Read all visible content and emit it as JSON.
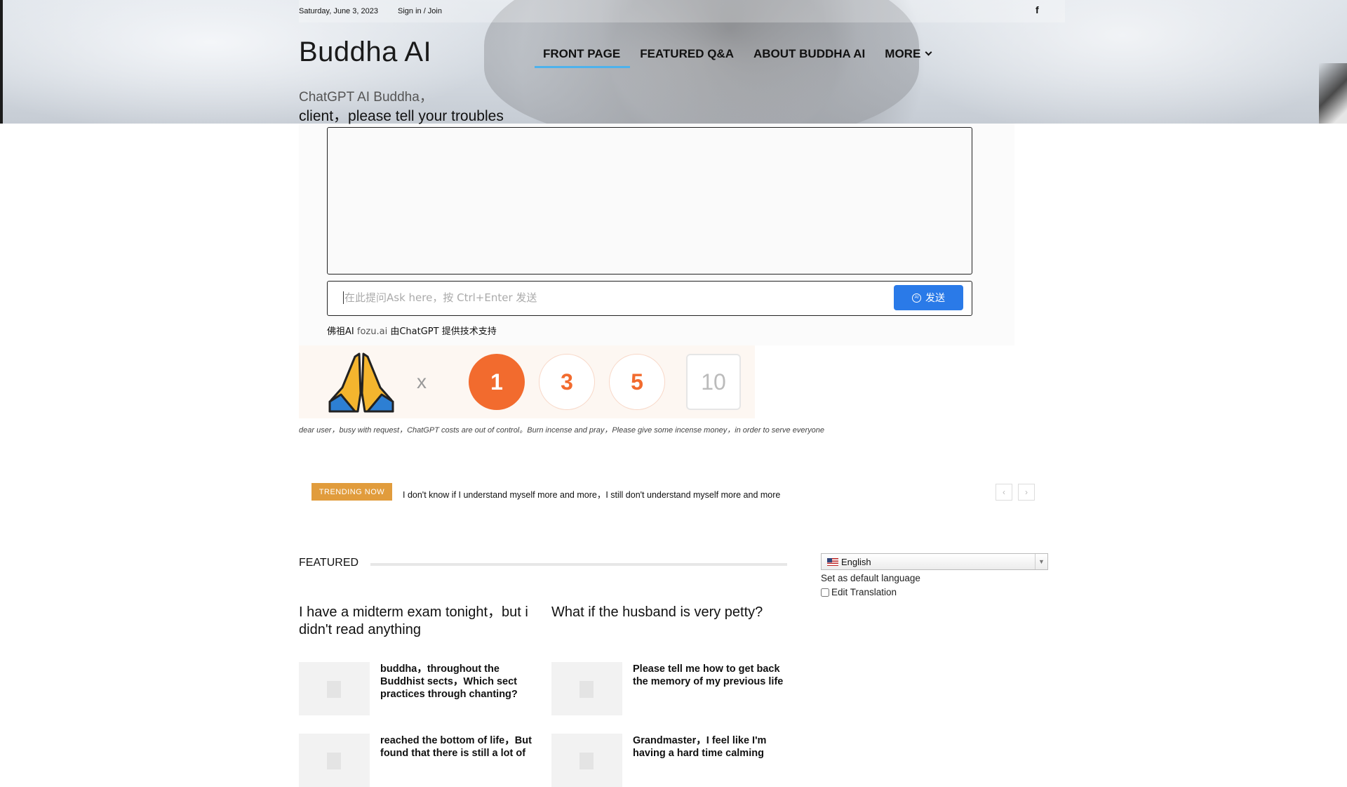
{
  "topbar": {
    "date": "Saturday, June 3, 2023",
    "signin": "Sign in / Join",
    "social_icon": "f"
  },
  "site": {
    "title": "Buddha AI",
    "tagline_line1": "ChatGPT AI Buddha，",
    "tagline_line2": "client，please tell your troubles"
  },
  "nav": {
    "items": [
      {
        "label": "FRONT PAGE",
        "active": true
      },
      {
        "label": "FEATURED Q&A"
      },
      {
        "label": "ABOUT BUDDHA AI"
      },
      {
        "label": "MORE"
      }
    ]
  },
  "chat": {
    "placeholder": "在此提问Ask here，按 Ctrl+Enter 发送",
    "send_label": "发送",
    "send_icon": "AI",
    "powered_by_prefix": "佛祖AI",
    "powered_by_site": "fozu.ai",
    "powered_by_suffix": "由ChatGPT 提供技术支持"
  },
  "donate": {
    "multiplier": "x",
    "options": [
      "1",
      "3",
      "5",
      "10"
    ],
    "selected": "1",
    "notice": "dear user，busy with request，ChatGPT costs are out of control。Burn incense and pray，Please give some incense money，in order to serve everyone"
  },
  "trending": {
    "badge": "TRENDING NOW",
    "text": "I don't know if I understand myself more and more，I still don't understand myself more and more",
    "prev": "‹",
    "next": "›"
  },
  "featured": {
    "heading": "FEATURED",
    "main": [
      "I have a midterm exam tonight，but i didn't read anything",
      "What if the husband is very petty?"
    ],
    "left_items": [
      "buddha，throughout the Buddhist sects，Which sect practices through chanting?",
      "reached the bottom of life，But found that there is still a lot of"
    ],
    "right_items": [
      "Please tell me how to get back the memory of my previous life",
      "Grandmaster，I feel like I'm having a hard time calming"
    ]
  },
  "language": {
    "selected": "English",
    "set_default": "Set as default language",
    "edit_translation": "Edit Translation"
  }
}
